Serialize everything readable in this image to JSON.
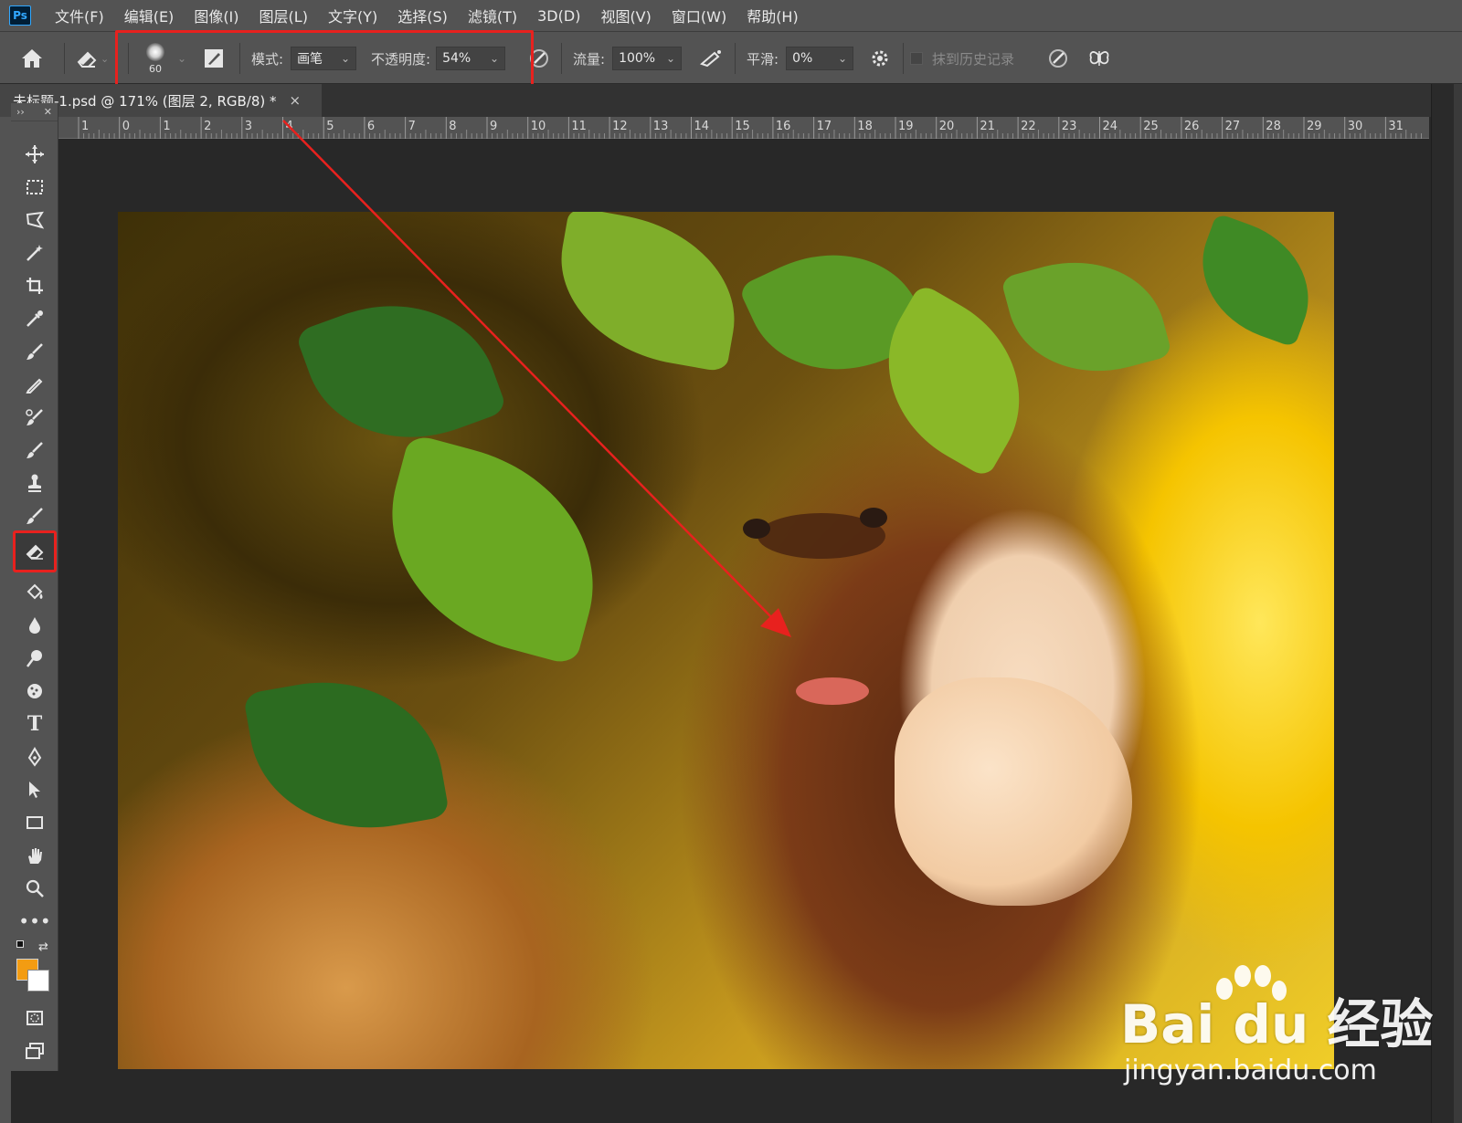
{
  "app": {
    "logo_text": "Ps"
  },
  "menu": [
    "文件(F)",
    "编辑(E)",
    "图像(I)",
    "图层(L)",
    "文字(Y)",
    "选择(S)",
    "滤镜(T)",
    "3D(D)",
    "视图(V)",
    "窗口(W)",
    "帮助(H)"
  ],
  "options": {
    "brush_size": "60",
    "mode_label": "模式:",
    "mode_value": "画笔",
    "opacity_label": "不透明度:",
    "opacity_value": "54%",
    "flow_label": "流量:",
    "flow_value": "100%",
    "smoothing_label": "平滑:",
    "smoothing_value": "0%",
    "erase_history_label": "抹到历史记录"
  },
  "document": {
    "tab_title": "未标题-1.psd @ 171% (图层 2, RGB/8) *",
    "close_glyph": "×"
  },
  "ruler": {
    "top_labels": [
      "1",
      "0",
      "1",
      "2",
      "3",
      "4",
      "5",
      "6",
      "7",
      "8",
      "9",
      "10",
      "11",
      "12",
      "13",
      "14",
      "15",
      "16",
      "17",
      "18",
      "19",
      "20",
      "21",
      "22",
      "23",
      "24",
      "25",
      "26",
      "27",
      "28",
      "29",
      "30",
      "31"
    ]
  },
  "colors": {
    "foreground": "#f39c12",
    "background": "#ffffff",
    "annotation": "#e8211e"
  },
  "watermark": {
    "brand": "Bai du 经验",
    "url": "jingyan.baidu.com"
  },
  "tools": [
    "move-tool",
    "marquee-tool",
    "lasso-tool",
    "magic-wand-tool",
    "crop-tool",
    "eyedropper-tool",
    "spot-healing-tool",
    "brush-tool",
    "clone-stamp-tool",
    "history-brush-tool",
    "eraser-tool",
    "paint-bucket-tool",
    "blur-tool",
    "dodge-tool",
    "sponge-tool",
    "type-tool",
    "pen-tool",
    "path-selection-tool",
    "rectangle-tool",
    "hand-tool",
    "zoom-tool",
    "more-tools"
  ]
}
